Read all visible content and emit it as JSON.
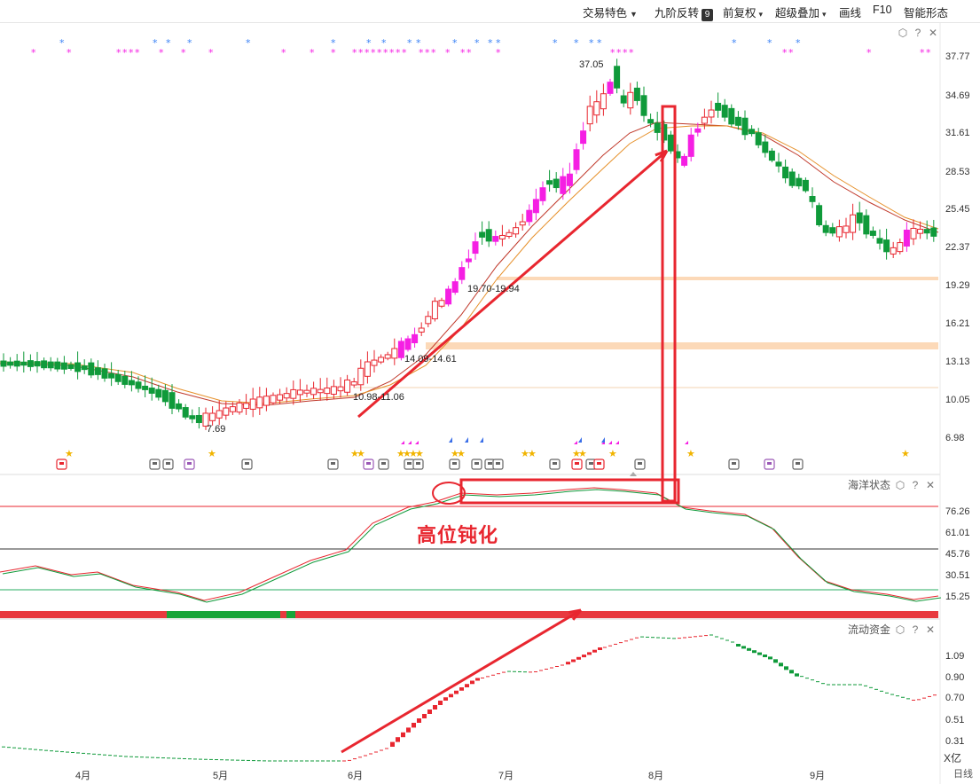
{
  "toolbar": {
    "trade_color": "交易特色",
    "nine_reversal": "九阶反转",
    "nine_badge": "9",
    "pre_adjust": "前复权",
    "overlay": "超级叠加",
    "draw_line": "画线",
    "f10": "F10",
    "pattern": "智能形态"
  },
  "price_axis": [
    "37.77",
    "34.69",
    "31.61",
    "28.53",
    "25.45",
    "22.37",
    "19.29",
    "16.21",
    "13.13",
    "10.05",
    "6.98"
  ],
  "price_notes": {
    "high": "37.05",
    "low": "7.69",
    "range1": "10.98-11.06",
    "range2": "14.09-14.61",
    "range3": "19.70-19.94"
  },
  "ocean_panel": {
    "title": "海洋状态",
    "axis": [
      "76.26",
      "61.01",
      "45.76",
      "30.51",
      "15.25"
    ]
  },
  "flow_panel": {
    "title": "流动资金",
    "axis": [
      "1.09",
      "0.90",
      "0.70",
      "0.51",
      "0.31"
    ],
    "unit": "X亿"
  },
  "months": [
    "4月",
    "5月",
    "6月",
    "7月",
    "8月",
    "9月"
  ],
  "period": "日线",
  "annotation": "高位钝化",
  "colors": {
    "up": "#e8262f",
    "down": "#0f9a3a",
    "magenta": "#f51fe3",
    "ma_orange": "#e6902a",
    "ma_red": "#c0392b",
    "zone": "#fcd9b8",
    "arrow": "#e8262f"
  }
}
